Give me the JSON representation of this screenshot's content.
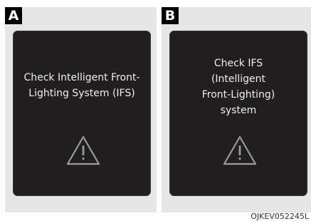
{
  "panels": [
    {
      "tag": "A",
      "lines": [
        "Check  Intelligent Front-",
        "Lighting System (IFS)"
      ],
      "icon": "warning-triangle-icon"
    },
    {
      "tag": "B",
      "lines": [
        "Check IFS",
        "(Intelligent",
        "Front-Lighting)",
        "system"
      ],
      "icon": "warning-triangle-icon"
    }
  ],
  "figure_code": "OJKEV052245L",
  "colors": {
    "panel_background": "#e6e6e6",
    "screen_background": "#201e1e",
    "text": "#efefef",
    "icon": "#9a9a9a",
    "tag_background": "#000000"
  }
}
